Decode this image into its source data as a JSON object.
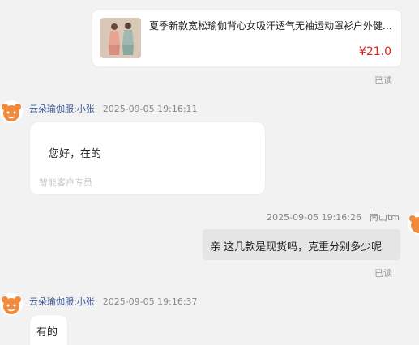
{
  "product": {
    "title": "夏季新款宽松瑜伽背心女吸汗透气无袖运动罩衫户外健...",
    "price": "¥21.0",
    "image_icon": "product-photo"
  },
  "read_status_1": "已读",
  "message_1": {
    "sender": "云朵瑜伽服:小张",
    "timestamp": "2025-09-05 19:16:11",
    "text": "您好，在的",
    "tag": "智能客户专员"
  },
  "message_2": {
    "sender": "南山tm",
    "timestamp": "2025-09-05 19:16:26",
    "text": "亲 这几款是现货吗，克重分别多少呢",
    "read_status": "已读"
  },
  "message_3": {
    "sender": "云朵瑜伽服:小张",
    "timestamp": "2025-09-05 19:16:37",
    "text": "有的"
  },
  "colors": {
    "background": "#f2f2f2",
    "price": "#e02020",
    "sender_name": "#3b5998",
    "outgoing_bubble": "#e5e5e5"
  }
}
